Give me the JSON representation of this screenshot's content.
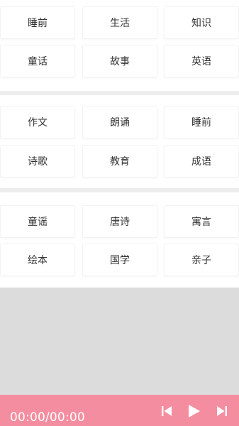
{
  "sections": [
    {
      "items": [
        {
          "label": "睡前"
        },
        {
          "label": "生活"
        },
        {
          "label": "知识"
        },
        {
          "label": "童话"
        },
        {
          "label": "故事"
        },
        {
          "label": "英语"
        }
      ]
    },
    {
      "items": [
        {
          "label": "作文"
        },
        {
          "label": "朗诵"
        },
        {
          "label": "睡前"
        },
        {
          "label": "诗歌"
        },
        {
          "label": "教育"
        },
        {
          "label": "成语"
        }
      ]
    },
    {
      "items": [
        {
          "label": "童谣"
        },
        {
          "label": "唐诗"
        },
        {
          "label": "寓言"
        },
        {
          "label": "绘本"
        },
        {
          "label": "国学"
        },
        {
          "label": "亲子"
        }
      ]
    }
  ],
  "player": {
    "time": "00:00/00:00",
    "controls": {
      "prev_icon": "skip-previous-icon",
      "play_icon": "play-icon",
      "next_icon": "skip-next-icon"
    },
    "colors": {
      "bar": "#f58da0",
      "blank_area": "#dcdcdc"
    }
  }
}
